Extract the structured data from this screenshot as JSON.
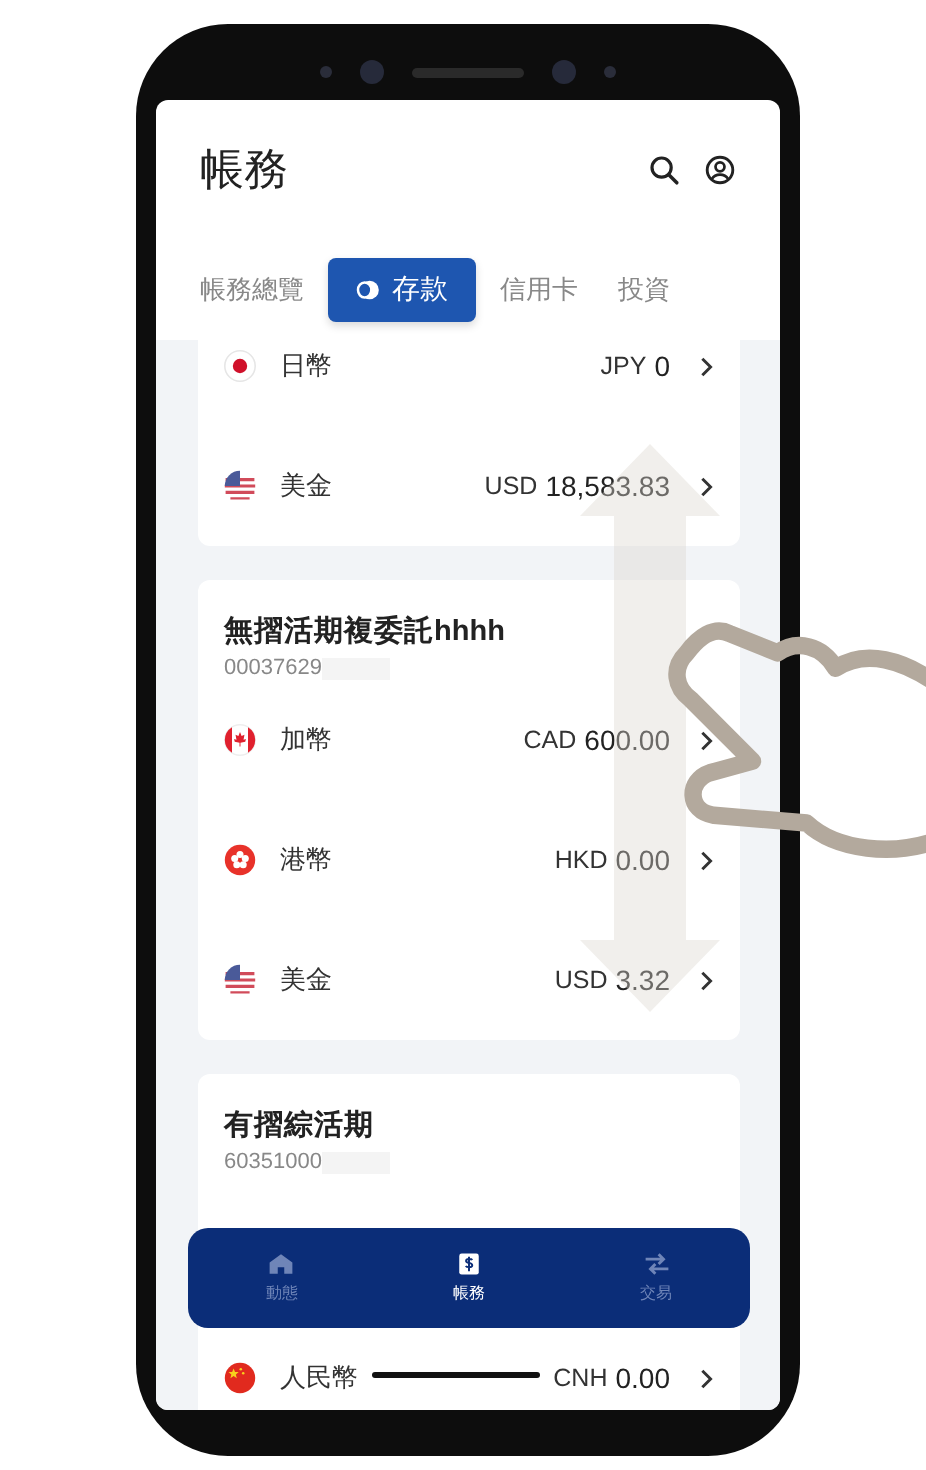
{
  "header": {
    "title": "帳務"
  },
  "tabs": [
    {
      "label": "帳務總覽",
      "selected": false
    },
    {
      "label": "存款",
      "selected": true
    },
    {
      "label": "信用卡",
      "selected": false
    },
    {
      "label": "投資",
      "selected": false
    }
  ],
  "accounts": [
    {
      "rows": [
        {
          "kind": "jp",
          "currency": "日幣",
          "code": "JPY",
          "amount": "0"
        },
        {
          "kind": "us",
          "currency": "美金",
          "code": "USD",
          "amount": "18,583.83"
        }
      ]
    },
    {
      "name": "無摺活期複委託hhhh",
      "number": "00037629",
      "rows": [
        {
          "kind": "ca",
          "currency": "加幣",
          "code": "CAD",
          "amount": "600.00"
        },
        {
          "kind": "hk",
          "currency": "港幣",
          "code": "HKD",
          "amount": "0.00"
        },
        {
          "kind": "us",
          "currency": "美金",
          "code": "USD",
          "amount": "3.32"
        }
      ]
    },
    {
      "name": "有摺綜活期",
      "number": "60351000",
      "rows": [
        {
          "kind": "cn",
          "currency": "人民幣",
          "code": "CNH",
          "amount": "0.00"
        }
      ]
    }
  ],
  "bottom_nav": [
    {
      "kind": "home",
      "label": "動態",
      "selected": false
    },
    {
      "kind": "dollar",
      "label": "帳務",
      "selected": true
    },
    {
      "kind": "transfer",
      "label": "交易",
      "selected": false
    }
  ]
}
